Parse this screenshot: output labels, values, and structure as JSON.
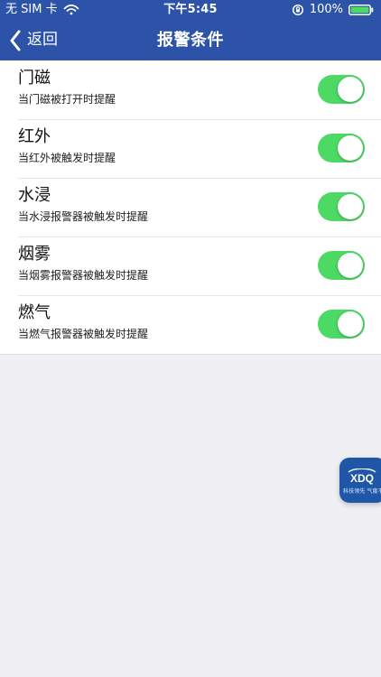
{
  "status_bar": {
    "carrier": "无 SIM 卡",
    "time": "下午5:45",
    "battery_percent": "100%"
  },
  "nav": {
    "back_label": "返回",
    "title": "报警条件"
  },
  "items": [
    {
      "title": "门磁",
      "subtitle": "当门磁被打开时提醒",
      "enabled": true
    },
    {
      "title": "红外",
      "subtitle": "当红外被触发时提醒",
      "enabled": true
    },
    {
      "title": "水浸",
      "subtitle": "当水浸报警器被触发时提醒",
      "enabled": true
    },
    {
      "title": "烟雾",
      "subtitle": "当烟雾报警器被触发时提醒",
      "enabled": true
    },
    {
      "title": "燃气",
      "subtitle": "当燃气报警器被触发时提醒",
      "enabled": true
    }
  ],
  "floating_badge": {
    "brand_text": "XDQ",
    "tagline": "科技领先 气度不凡"
  },
  "colors": {
    "nav_background": "#2c53a8",
    "toggle_on": "#4cd964",
    "page_background": "#efeff4",
    "badge_background": "#1f56a8"
  }
}
